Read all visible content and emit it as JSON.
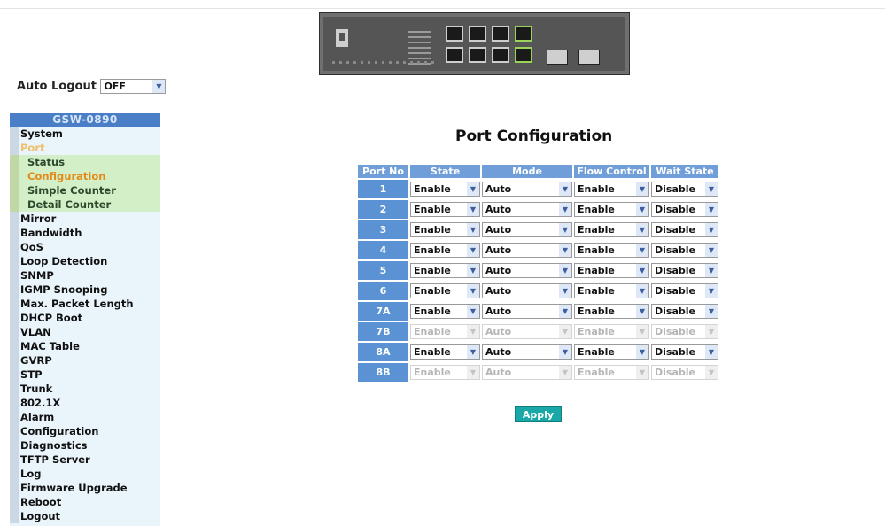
{
  "autologout": {
    "label": "Auto Logout",
    "value": "OFF"
  },
  "sidebar": {
    "title": "GSW-0890",
    "items": [
      {
        "label": "System",
        "type": "item"
      },
      {
        "label": "Port",
        "type": "active"
      },
      {
        "label": "Status",
        "type": "sub"
      },
      {
        "label": "Configuration",
        "type": "sub-current"
      },
      {
        "label": "Simple Counter",
        "type": "sub"
      },
      {
        "label": "Detail Counter",
        "type": "sub"
      },
      {
        "label": "Mirror",
        "type": "item"
      },
      {
        "label": "Bandwidth",
        "type": "item"
      },
      {
        "label": "QoS",
        "type": "item"
      },
      {
        "label": "Loop Detection",
        "type": "item"
      },
      {
        "label": "SNMP",
        "type": "item"
      },
      {
        "label": "IGMP Snooping",
        "type": "item"
      },
      {
        "label": "Max. Packet Length",
        "type": "item"
      },
      {
        "label": "DHCP Boot",
        "type": "item"
      },
      {
        "label": "VLAN",
        "type": "item"
      },
      {
        "label": "MAC Table",
        "type": "item"
      },
      {
        "label": "GVRP",
        "type": "item"
      },
      {
        "label": "STP",
        "type": "item"
      },
      {
        "label": "Trunk",
        "type": "item"
      },
      {
        "label": "802.1X",
        "type": "item"
      },
      {
        "label": "Alarm",
        "type": "item"
      },
      {
        "label": "Configuration",
        "type": "item"
      },
      {
        "label": "Diagnostics",
        "type": "item"
      },
      {
        "label": "TFTP Server",
        "type": "item"
      },
      {
        "label": "Log",
        "type": "item"
      },
      {
        "label": "Firmware Upgrade",
        "type": "item"
      },
      {
        "label": "Reboot",
        "type": "item"
      },
      {
        "label": "Logout",
        "type": "item"
      }
    ]
  },
  "main": {
    "title": "Port Configuration",
    "columns": [
      "Port No",
      "State",
      "Mode",
      "Flow Control",
      "Wait State"
    ],
    "rows": [
      {
        "port": "1",
        "state": "Enable",
        "mode": "Auto",
        "flow": "Enable",
        "wait": "Disable",
        "disabled": false
      },
      {
        "port": "2",
        "state": "Enable",
        "mode": "Auto",
        "flow": "Enable",
        "wait": "Disable",
        "disabled": false
      },
      {
        "port": "3",
        "state": "Enable",
        "mode": "Auto",
        "flow": "Enable",
        "wait": "Disable",
        "disabled": false
      },
      {
        "port": "4",
        "state": "Enable",
        "mode": "Auto",
        "flow": "Enable",
        "wait": "Disable",
        "disabled": false
      },
      {
        "port": "5",
        "state": "Enable",
        "mode": "Auto",
        "flow": "Enable",
        "wait": "Disable",
        "disabled": false
      },
      {
        "port": "6",
        "state": "Enable",
        "mode": "Auto",
        "flow": "Enable",
        "wait": "Disable",
        "disabled": false
      },
      {
        "port": "7A",
        "state": "Enable",
        "mode": "Auto",
        "flow": "Enable",
        "wait": "Disable",
        "disabled": false
      },
      {
        "port": "7B",
        "state": "Enable",
        "mode": "Auto",
        "flow": "Enable",
        "wait": "Disable",
        "disabled": true
      },
      {
        "port": "8A",
        "state": "Enable",
        "mode": "Auto",
        "flow": "Enable",
        "wait": "Disable",
        "disabled": false
      },
      {
        "port": "8B",
        "state": "Enable",
        "mode": "Auto",
        "flow": "Enable",
        "wait": "Disable",
        "disabled": true
      }
    ],
    "apply_label": "Apply"
  },
  "icons": {
    "device": "switch-front-panel-image",
    "dropdown": "chevron-down-icon"
  }
}
